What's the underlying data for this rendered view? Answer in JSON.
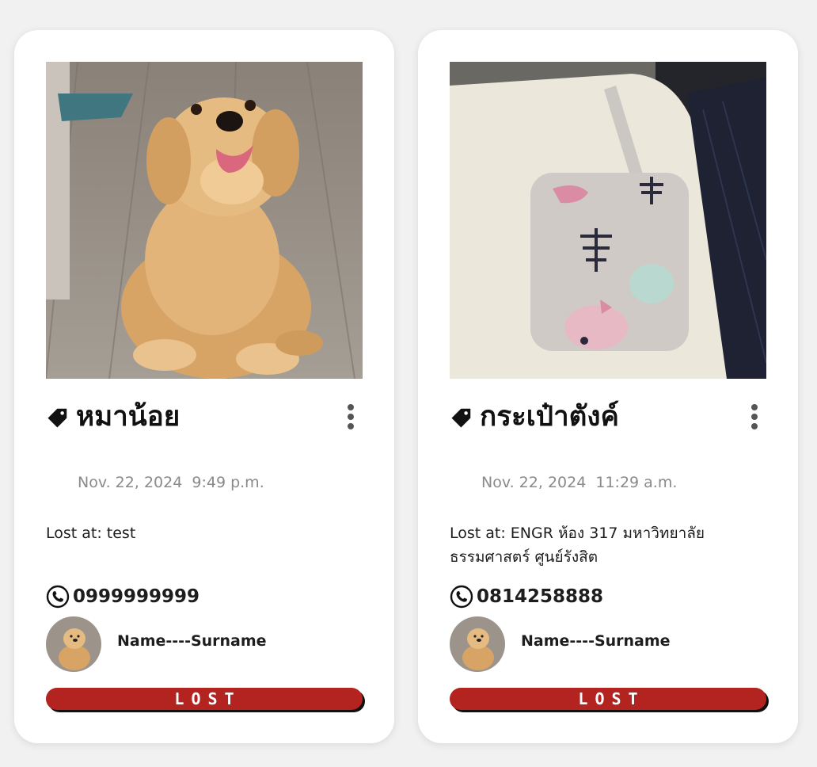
{
  "posts": [
    {
      "image": "puppy-photo",
      "title": "หมาน้อย",
      "date": "Nov. 22, 2024  9:49 p.m.",
      "lost_at": "Lost at: test",
      "phone": "0999999999",
      "owner_name": "Name----Surname",
      "status": "LOST"
    },
    {
      "image": "pouch-photo",
      "title": "กระเป๋าตังค์",
      "date": "Nov. 22, 2024  11:29 a.m.",
      "lost_at": "Lost at: ENGR ห้อง 317 มหาวิทยาลัยธรรมศาสตร์ ศูนย์รังสิต",
      "phone": "0814258888",
      "owner_name": "Name----Surname",
      "status": "LOST"
    }
  ],
  "icons": {
    "tag": "tag-icon",
    "more": "kebab-menu-icon",
    "phone": "phone-icon"
  },
  "colors": {
    "status_lost": "#b3231f",
    "background": "#f1f1f1",
    "card": "#ffffff"
  }
}
